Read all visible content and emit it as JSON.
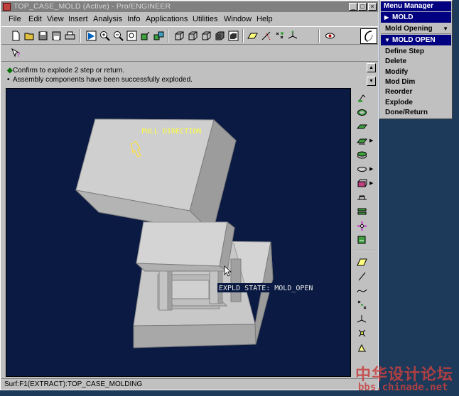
{
  "window": {
    "title": "TOP_CASE_MOLD (Active) - Pro/ENGINEER",
    "minimize": "_",
    "maximize": "□",
    "close": "×"
  },
  "menubar": [
    "File",
    "Edit",
    "View",
    "Insert",
    "Analysis",
    "Info",
    "Applications",
    "Utilities",
    "Window",
    "Help"
  ],
  "messages": [
    {
      "mark": "◆",
      "text": "Confirm to explode 2 step or return."
    },
    {
      "mark": "•",
      "text": "Assembly components have been successfully exploded."
    }
  ],
  "viewport": {
    "label_pull": "PULL DIRECTION",
    "label_state": "EXPLD STATE: MOLD_OPEN",
    "background": "#0b1a42"
  },
  "statusbar": {
    "text": "Surf:F1(EXTRACT):TOP_CASE_MOLDING"
  },
  "menu_manager": {
    "title": "Menu Manager",
    "mold_header": "MOLD",
    "mold_opening": "Mold Opening",
    "mold_open_header": "MOLD OPEN",
    "items": [
      "Define Step",
      "Delete",
      "Modify",
      "Mod Dim",
      "Reorder",
      "Explode",
      "Done/Return"
    ]
  },
  "watermark": {
    "chinese": "中华设计论坛",
    "url": "bbs.chinade.net"
  },
  "colors": {
    "menu_header": "#000080",
    "viewport_bg": "#0b1a42",
    "model_face": "#c8c8c8",
    "label_pull": "#ffff40",
    "watermark": "#c84040"
  }
}
